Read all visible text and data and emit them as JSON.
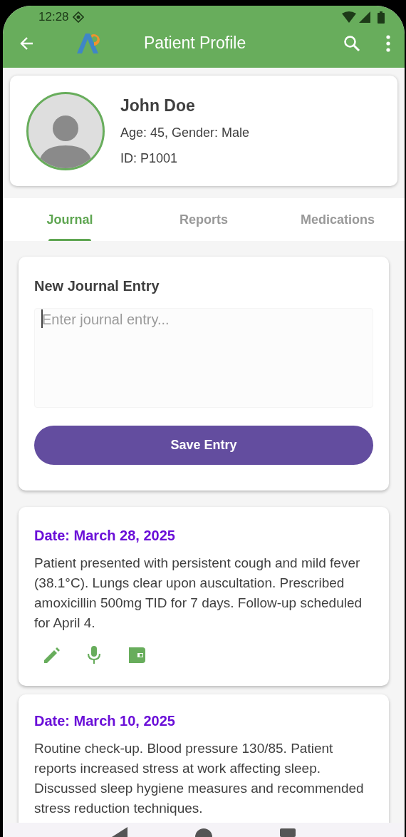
{
  "status_bar": {
    "time": "12:28"
  },
  "app_bar": {
    "title": "Patient Profile"
  },
  "profile": {
    "name": "John Doe",
    "details": "Age: 45, Gender: Male",
    "id": "ID: P1001"
  },
  "tabs": [
    {
      "label": "Journal",
      "selected": true
    },
    {
      "label": "Reports",
      "selected": false
    },
    {
      "label": "Medications",
      "selected": false
    }
  ],
  "new_entry": {
    "title": "New Journal Entry",
    "placeholder": "Enter journal entry...",
    "button": "Save Entry"
  },
  "entries": [
    {
      "date": "Date: March 28, 2025",
      "text": "Patient presented with persistent cough and mild fever (38.1°C). Lungs clear upon auscultation. Prescribed amoxicillin 500mg TID for 7 days. Follow-up scheduled for April 4.",
      "actions": true
    },
    {
      "date": "Date: March 10, 2025",
      "text": "Routine check-up. Blood pressure 130/85. Patient reports increased stress at work affecting sleep. Discussed sleep hygiene measures and recommended stress reduction techniques.",
      "actions": false
    }
  ]
}
